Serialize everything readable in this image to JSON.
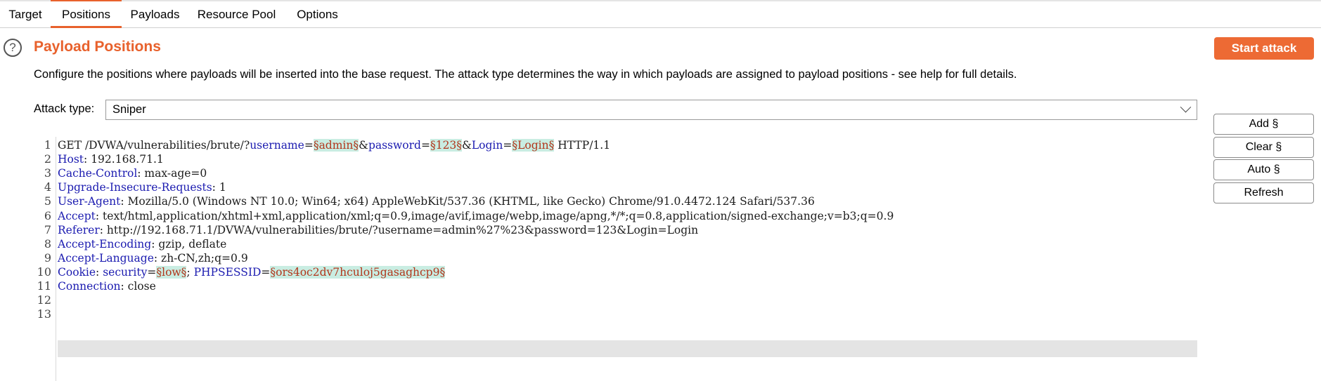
{
  "tabs": [
    "Target",
    "Positions",
    "Payloads",
    "Resource Pool",
    "Options"
  ],
  "active_tab": "Positions",
  "accent_color": "#e8612c",
  "section": {
    "help_icon": "question-circle-icon",
    "help_glyph": "?",
    "title": "Payload Positions",
    "description": "Configure the positions where payloads will be inserted into the base request. The attack type determines the way in which payloads are assigned to payload positions - see help for full details."
  },
  "start_attack_label": "Start attack",
  "attack_type": {
    "label": "Attack type:",
    "value": "Sniper"
  },
  "side_buttons": [
    "Add §",
    "Clear §",
    "Auto §",
    "Refresh"
  ],
  "request": {
    "line_numbers": [
      "1",
      "2",
      "3",
      "4",
      "5",
      "6",
      "7",
      "8",
      "9",
      "10",
      "11",
      "12",
      "13"
    ],
    "lines": [
      [
        {
          "t": "GET /DVWA/vulnerabilities/brute/?"
        },
        {
          "t": "username",
          "c": "pk"
        },
        {
          "t": "="
        },
        {
          "t": "§admin§",
          "c": "pos"
        },
        {
          "t": "&"
        },
        {
          "t": "password",
          "c": "pk"
        },
        {
          "t": "="
        },
        {
          "t": "§123§",
          "c": "pos"
        },
        {
          "t": "&"
        },
        {
          "t": "Login",
          "c": "pk"
        },
        {
          "t": "="
        },
        {
          "t": "§Login§",
          "c": "pos"
        },
        {
          "t": " HTTP/1.1"
        }
      ],
      [
        {
          "t": "Host",
          "c": "hn"
        },
        {
          "t": ": 192.168.71.1"
        }
      ],
      [
        {
          "t": "Cache-Control",
          "c": "hn"
        },
        {
          "t": ": max-age=0"
        }
      ],
      [
        {
          "t": "Upgrade-Insecure-Requests",
          "c": "hn"
        },
        {
          "t": ": 1"
        }
      ],
      [
        {
          "t": "User-Agent",
          "c": "hn"
        },
        {
          "t": ": Mozilla/5.0 (Windows NT 10.0; Win64; x64) AppleWebKit/537.36 (KHTML, like Gecko) Chrome/91.0.4472.124 Safari/537.36"
        }
      ],
      [
        {
          "t": "Accept",
          "c": "hn"
        },
        {
          "t": ": text/html,application/xhtml+xml,application/xml;q=0.9,image/avif,image/webp,image/apng,*/*;q=0.8,application/signed-exchange;v=b3;q=0.9"
        }
      ],
      [
        {
          "t": "Referer",
          "c": "hn"
        },
        {
          "t": ": http://192.168.71.1/DVWA/vulnerabilities/brute/?username=admin%27%23&password=123&Login=Login"
        }
      ],
      [
        {
          "t": "Accept-Encoding",
          "c": "hn"
        },
        {
          "t": ": gzip, deflate"
        }
      ],
      [
        {
          "t": "Accept-Language",
          "c": "hn"
        },
        {
          "t": ": zh-CN,zh;q=0.9"
        }
      ],
      [
        {
          "t": "Cookie",
          "c": "hn"
        },
        {
          "t": ": "
        },
        {
          "t": "security",
          "c": "pk"
        },
        {
          "t": "="
        },
        {
          "t": "§low§",
          "c": "pos"
        },
        {
          "t": "; "
        },
        {
          "t": "PHPSESSID",
          "c": "pk"
        },
        {
          "t": "="
        },
        {
          "t": "§ors4oc2dv7hculoj5gasaghcp9§",
          "c": "pos"
        }
      ],
      [
        {
          "t": "Connection",
          "c": "hn"
        },
        {
          "t": ": close"
        }
      ],
      [],
      []
    ]
  }
}
